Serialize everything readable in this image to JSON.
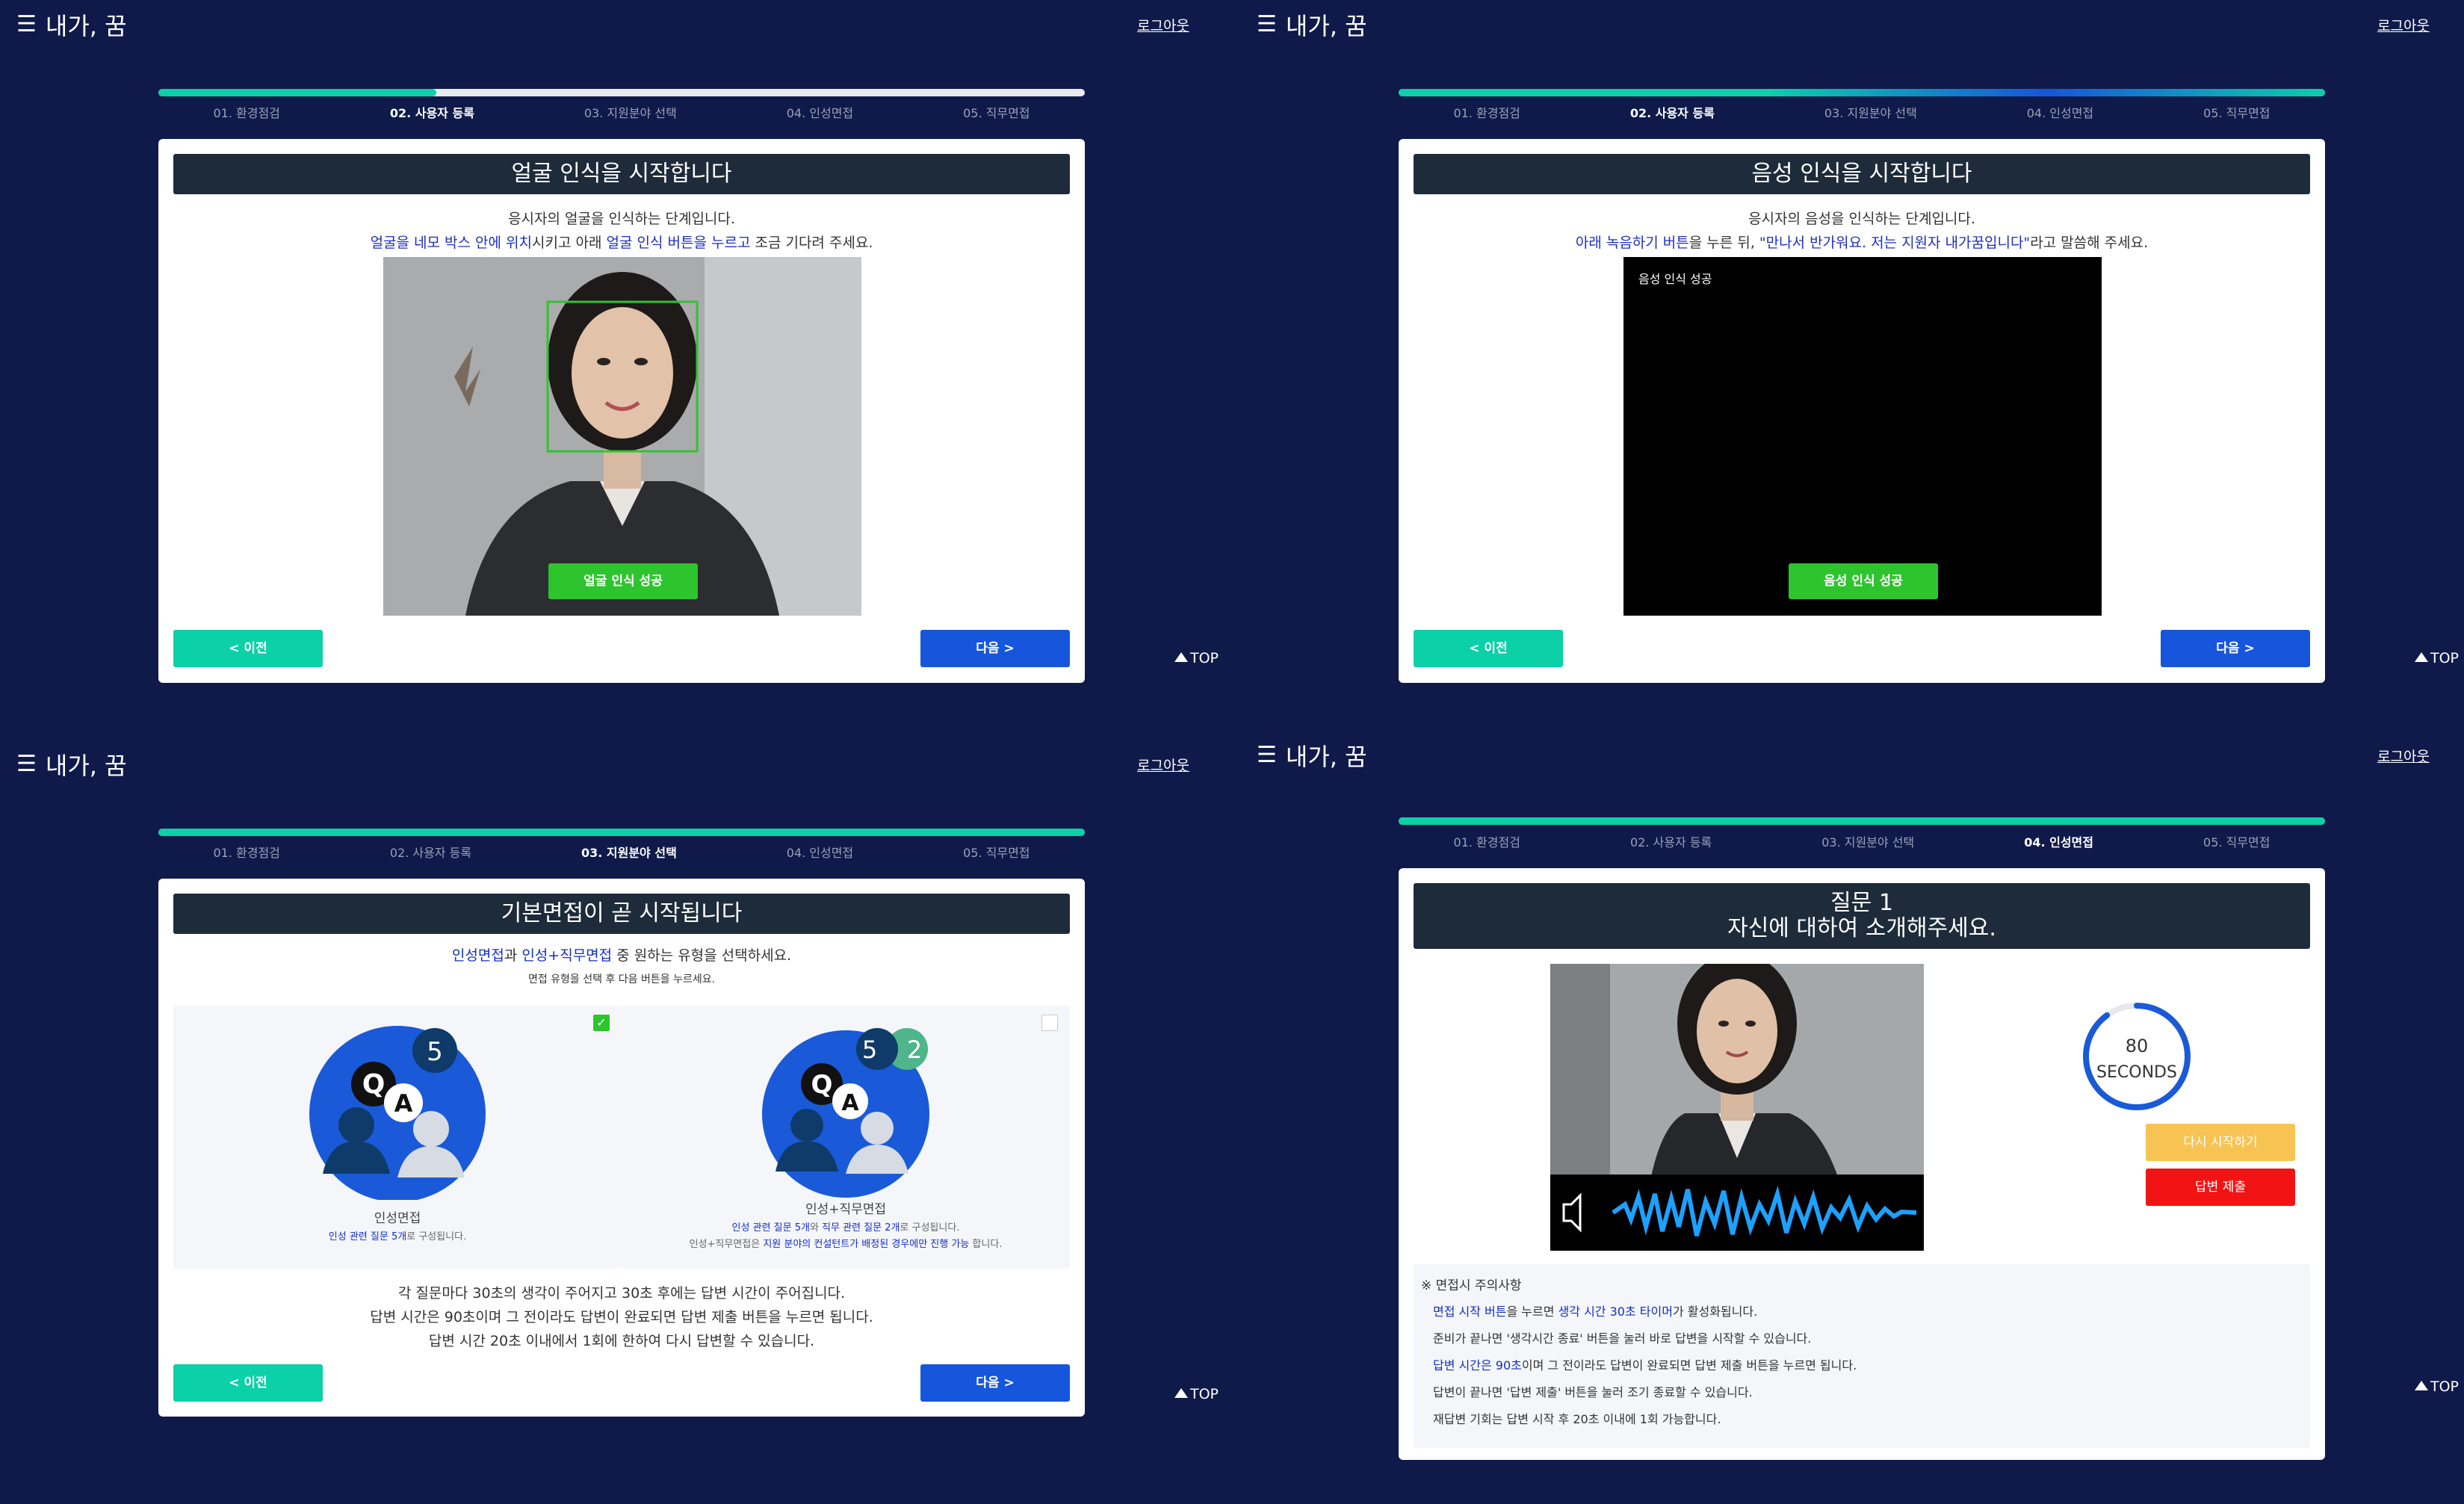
{
  "brand": "내가, 꿈",
  "logout": "로그아웃",
  "top": "TOP",
  "steps": [
    "01. 환경점검",
    "02. 사용자 등록",
    "03. 지원분야 선택",
    "04. 인성면접",
    "05. 직무면접"
  ],
  "colors": {
    "bg": "#0f1a4a",
    "accent": "#0bd0a8",
    "primary": "#1656dd",
    "success": "#2ec42e"
  },
  "nav": {
    "prev": "< 이전",
    "next": "다음 >"
  },
  "face": {
    "title": "얼굴 인식을 시작합니다",
    "line1": "응시자의 얼굴을 인식하는 단계입니다.",
    "line2_a": "얼굴을 네모 박스 안에 위치",
    "line2_b": "시키고 아래 ",
    "line2_c": "얼굴 인식 버튼을 누르고",
    "line2_d": " 조금 기다려 주세요.",
    "button": "얼굴 인식 성공"
  },
  "voice": {
    "title": "음성 인식을 시작합니다",
    "line1": "응시자의 음성을 인식하는 단계입니다.",
    "line2_a": "아래 녹음하기 버튼",
    "line2_b": "을 누른 뒤, ",
    "line2_c": "\"만나서 반가워요. 저는 지원자 내가꿈입니다\"",
    "line2_d": "라고 말씀해 주세요.",
    "status": "음성 인식 성공",
    "button": "음성 인식 성공"
  },
  "select": {
    "title": "기본면접이 곧 시작됩니다",
    "line1_a": "인성면접",
    "line1_b": "과 ",
    "line1_c": "인성+직무면접",
    "line1_d": " 중 원하는 유형을 선택하세요.",
    "line2": "면접 유형을 선택 후 다음 버튼을 누르세요.",
    "opt1_name": "인성면접",
    "opt1_sub_a": "인성 관련 질문 5개",
    "opt1_sub_b": "로 구성됩니다.",
    "opt1_count": "5",
    "opt2_name": "인성+직무면접",
    "opt2_sub1_a": "인성 관련 질문 5개",
    "opt2_sub1_b": "와 ",
    "opt2_sub1_c": "직무 관련 질문 2개",
    "opt2_sub1_d": "로 구성됩니다.",
    "opt2_sub2_a": "인성+직무면접은 ",
    "opt2_sub2_b": "지원 분야의 컨설턴트가 배정된 경우에만 진행 가능",
    "opt2_sub2_c": " 합니다.",
    "opt2_count_a": "5",
    "opt2_count_b": "2",
    "note1": "각 질문마다 30초의 생각이 주어지고 30초 후에는 답변 시간이 주어집니다.",
    "note2": "답변 시간은 90초이며 그 전이라도 답변이 완료되면 답변 제출 버튼을 누르면 됩니다.",
    "note3": "답변 시간 20초 이내에서 1회에 한하여 다시 답변할 수 있습니다."
  },
  "interview": {
    "q_label": "질문 1",
    "q_text": "자신에 대하여 소개해주세요.",
    "timer_value": "80",
    "timer_unit": "SECONDS",
    "timer_fraction": 0.9,
    "restart": "다시 시작하기",
    "submit": "답변 제출",
    "notice_title": "※ 면접시 주의사항",
    "n1_a": "면접 시작 버튼",
    "n1_b": "을 누르면 ",
    "n1_c": "생각 시간 30초 타이머",
    "n1_d": "가 활성화됩니다.",
    "n2": "준비가 끝나면 '생각시간 종료' 버튼을 눌러 바로 답변을 시작할 수 있습니다.",
    "n3_a": "답변 시간은 90초",
    "n3_b": "이며 그 전이라도 답변이 완료되면 답변 제출 버튼을 누르면 됩니다.",
    "n4": "답변이 끝나면 '답변 제출' 버튼을 눌러 조기 종료할 수 있습니다.",
    "n5": "재답변 기회는 답변 시작 후 20초 이내에 1회 가능합니다."
  }
}
